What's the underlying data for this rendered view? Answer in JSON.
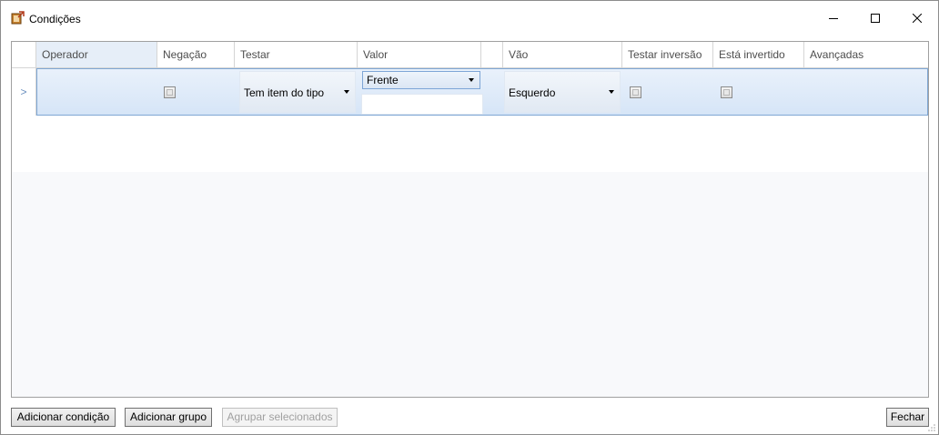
{
  "window": {
    "title": "Condições",
    "minimize_icon": "minimize-icon",
    "maximize_icon": "maximize-icon",
    "close_icon": "close-icon"
  },
  "grid": {
    "columns": [
      "Operador",
      "Negação",
      "Testar",
      "Valor",
      "",
      "Vão",
      "Testar inversão",
      "Está invertido",
      "Avançadas"
    ],
    "rows": [
      {
        "row_indicator": ">",
        "operador": "",
        "negacao": false,
        "testar": "Tem item do tipo",
        "valor": "Frente",
        "valor_text": "",
        "vao": "Esquerdo",
        "testar_inversao": false,
        "esta_invertido": false,
        "avancadas": ""
      }
    ]
  },
  "buttons": {
    "add_condition": "Adicionar condição",
    "add_group": "Adicionar grupo",
    "group_selected": "Agrupar selecionados",
    "close": "Fechar"
  },
  "colors": {
    "selection_row": "#d6e5f7",
    "selection_border": "#7fa7d4",
    "header_text": "#4d4d4d"
  }
}
